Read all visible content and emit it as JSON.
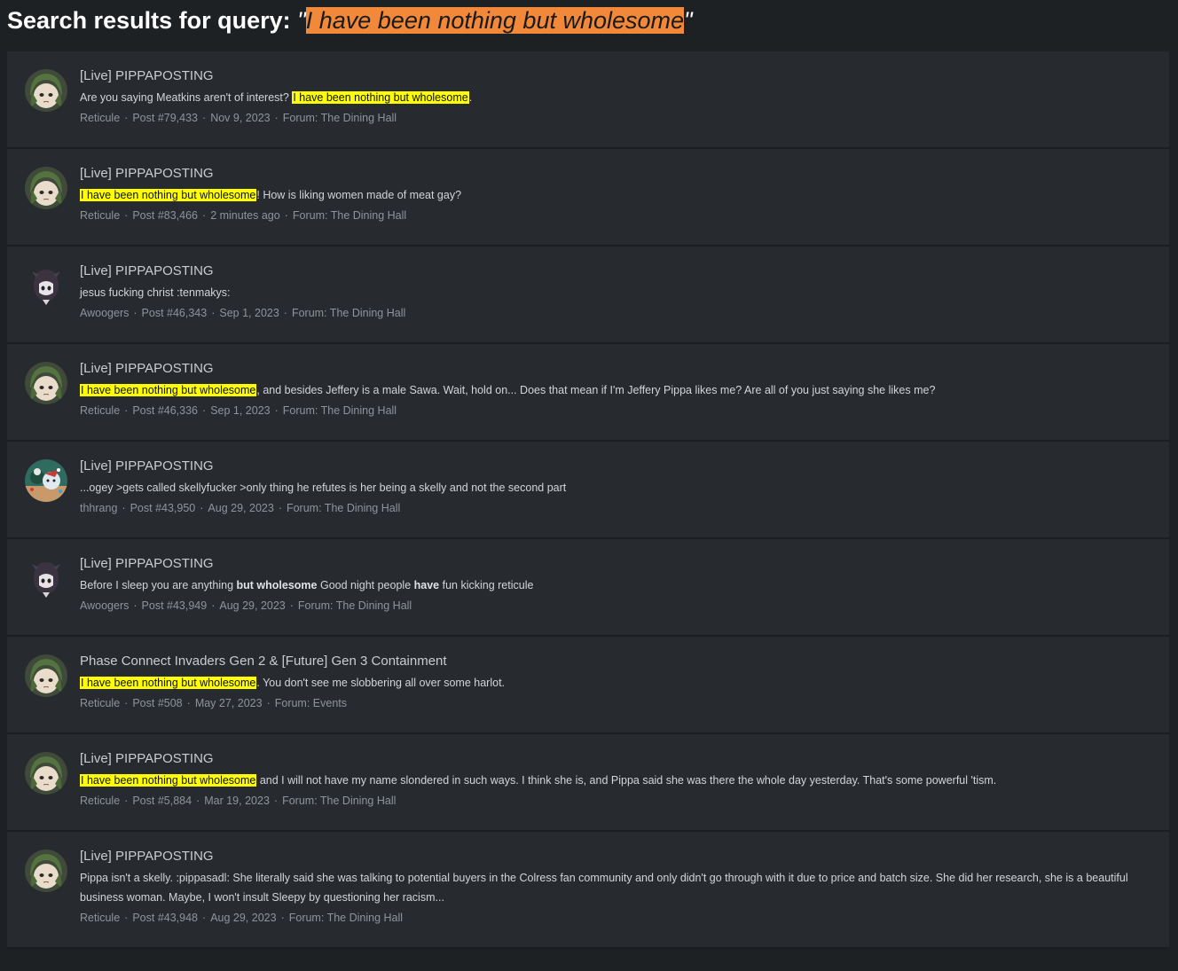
{
  "page": {
    "heading": "Search results for query:",
    "query_open": "\"",
    "query_highlight": "I have been nothing but wholesome",
    "query_close": "\""
  },
  "colors": {
    "background": "#1e2124",
    "card": "#272b2f",
    "highlight": "#ffff00",
    "query_highlight": "#f2893a"
  },
  "results": [
    {
      "thread": "[Live] PIPPAPOSTING",
      "avatar": "green-hair-avatar",
      "snippet_pre": "Are you saying Meatkins aren't of interest? ",
      "snippet_hl": "I have been nothing but wholesome",
      "snippet_post": ".",
      "user": "Reticule",
      "post": "Post #79,433",
      "date": "Nov 9, 2023",
      "forum": "Forum: The Dining Hall"
    },
    {
      "thread": "[Live] PIPPAPOSTING",
      "avatar": "green-hair-avatar",
      "snippet_pre": "",
      "snippet_hl": "I have been nothing but wholesome",
      "snippet_post": "! How is liking women made of meat gay?",
      "user": "Reticule",
      "post": "Post #83,466",
      "date": "2 minutes ago",
      "forum": "Forum: The Dining Hall"
    },
    {
      "thread": "[Live] PIPPAPOSTING",
      "avatar": "dark-hair-avatar",
      "snippet_pre": "jesus fucking christ :tenmakys:",
      "snippet_hl": "",
      "snippet_post": "",
      "user": "Awoogers",
      "post": "Post #46,343",
      "date": "Sep 1, 2023",
      "forum": "Forum: The Dining Hall"
    },
    {
      "thread": "[Live] PIPPAPOSTING",
      "avatar": "green-hair-avatar",
      "snippet_pre": "",
      "snippet_hl": "I have been nothing but wholesome",
      "snippet_post": ", and besides Jeffery is a male Sawa. Wait, hold on... Does that mean if I'm Jeffery Pippa likes me? Are all of you just saying she likes me?",
      "user": "Reticule",
      "post": "Post #46,336",
      "date": "Sep 1, 2023",
      "forum": "Forum: The Dining Hall"
    },
    {
      "thread": "[Live] PIPPAPOSTING",
      "avatar": "festive-avatar",
      "snippet_pre": "...ogey >gets called skellyfucker >only thing he refutes is her being a skelly and not the second part",
      "snippet_hl": "",
      "snippet_post": "",
      "user": "thhrang",
      "post": "Post #43,950",
      "date": "Aug 29, 2023",
      "forum": "Forum: The Dining Hall"
    },
    {
      "thread": "[Live] PIPPAPOSTING",
      "avatar": "dark-hair-avatar",
      "snippet_pre": "Before I sleep you are anything ",
      "snippet_bold1": "but wholesome",
      "snippet_mid": " Good night people ",
      "snippet_bold2": "have",
      "snippet_end": " fun kicking reticule",
      "user": "Awoogers",
      "post": "Post #43,949",
      "date": "Aug 29, 2023",
      "forum": "Forum: The Dining Hall"
    },
    {
      "thread": "Phase Connect Invaders Gen 2 & [Future] Gen 3 Containment",
      "avatar": "green-hair-avatar",
      "snippet_pre": "",
      "snippet_hl": "I have been nothing but wholesome",
      "snippet_post": ". You don't see me slobbering all over some harlot.",
      "user": "Reticule",
      "post": "Post #508",
      "date": "May 27, 2023",
      "forum": "Forum: Events"
    },
    {
      "thread": "[Live] PIPPAPOSTING",
      "avatar": "green-hair-avatar",
      "snippet_pre": "",
      "snippet_hl": "I have been nothing but wholesome",
      "snippet_post": " and I will not have my name slondered in such ways. I think she is, and Pippa said she was there the whole day yesterday. That's some powerful 'tism.",
      "user": "Reticule",
      "post": "Post #5,884",
      "date": "Mar 19, 2023",
      "forum": "Forum: The Dining Hall"
    },
    {
      "thread": "[Live] PIPPAPOSTING",
      "avatar": "green-hair-avatar",
      "snippet_pre": "Pippa isn't a skelly. :pippasadl: She literally said she was talking to potential buyers in the Colress fan community and only didn't go through with it due to price and batch size. She did her research, she is a beautiful business woman. Maybe, I won't insult Sleepy by questioning her racism...",
      "snippet_hl": "",
      "snippet_post": "",
      "user": "Reticule",
      "post": "Post #43,948",
      "date": "Aug 29, 2023",
      "forum": "Forum: The Dining Hall"
    }
  ]
}
